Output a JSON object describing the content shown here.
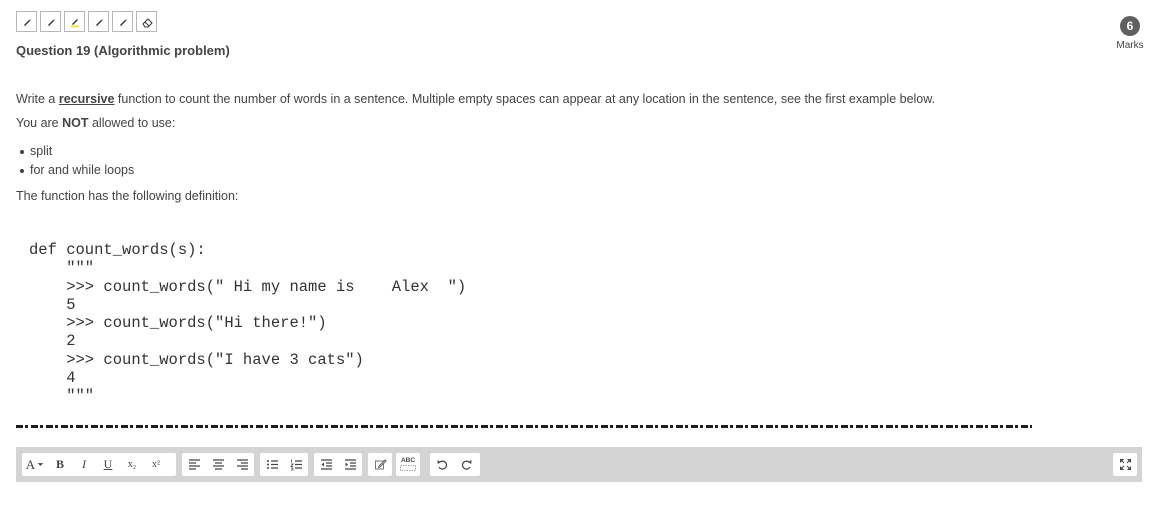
{
  "marks": {
    "value": "6",
    "label": "Marks"
  },
  "question": {
    "title": "Question 19 (Algorithmic problem)"
  },
  "text": {
    "line1_a": "Write a ",
    "line1_recursive": "recursive",
    "line1_b": " function to count the number of words in a sentence. Multiple empty spaces can appear at any location in the sentence, see the first example below.",
    "line2_a": "You are ",
    "line2_not": "NOT",
    "line2_b": " allowed to use:",
    "bullets": [
      "split",
      "for and while loops"
    ],
    "line3": "The function has the following definition:"
  },
  "code": "def count_words(s):\n    \"\"\"\n    >>> count_words(\" Hi my name is    Alex  \")\n    5\n    >>> count_words(\"Hi there!\")\n    2\n    >>> count_words(\"I have 3 cats\")\n    4\n    \"\"\"",
  "editor": {
    "font_label": "A",
    "bold": "B",
    "italic": "I",
    "underline": "U",
    "subscript": "x₂",
    "superscript": "x²",
    "spell_label": "ABC"
  },
  "tools": [
    "pen-icon",
    "pen-icon",
    "highlighter-yellow-icon",
    "pen-icon",
    "pen-icon",
    "eraser-icon"
  ]
}
